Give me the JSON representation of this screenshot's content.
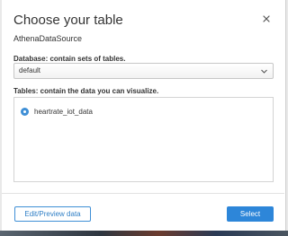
{
  "dialog": {
    "title": "Choose your table",
    "subtitle": "AthenaDataSource",
    "database_label": "Database: contain sets of tables.",
    "database_value": "default",
    "tables_label": "Tables: contain the data you can visualize.",
    "tables": [
      {
        "label": "heartrate_iot_data",
        "selected": true
      }
    ],
    "edit_button": "Edit/Preview data",
    "select_button": "Select"
  },
  "colors": {
    "accent": "#2d86d9",
    "radio": "#3f8fd6"
  },
  "icons": {
    "close": "close-icon",
    "chevron": "chevron-down-icon"
  }
}
